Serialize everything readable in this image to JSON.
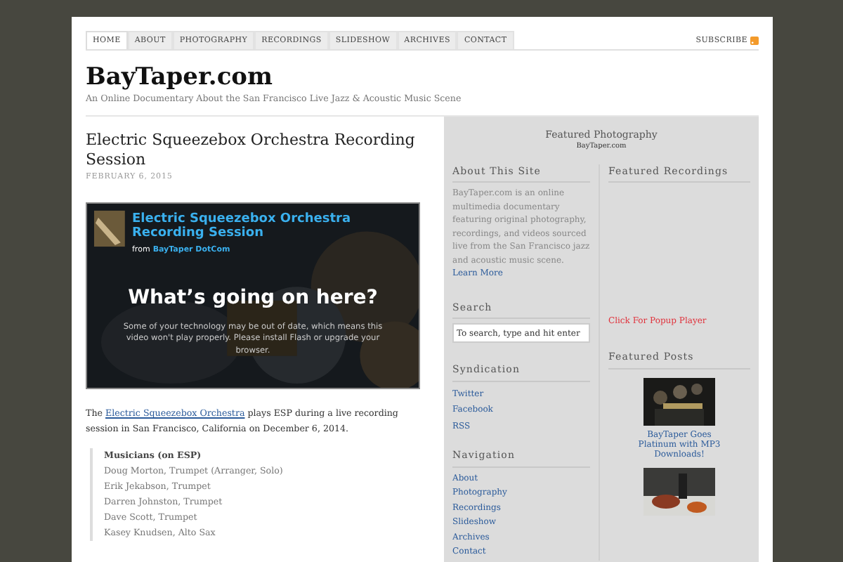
{
  "nav": {
    "tabs": [
      {
        "label": "HOME",
        "selected": true
      },
      {
        "label": "ABOUT",
        "selected": false
      },
      {
        "label": "PHOTOGRAPHY",
        "selected": false
      },
      {
        "label": "RECORDINGS",
        "selected": false
      },
      {
        "label": "SLIDESHOW",
        "selected": false
      },
      {
        "label": "ARCHIVES",
        "selected": false
      },
      {
        "label": "CONTACT",
        "selected": false
      }
    ],
    "subscribe": "SUBSCRIBE"
  },
  "site": {
    "title": "BayTaper.com",
    "tagline": "An Online Documentary About the San Francisco Live Jazz & Acoustic Music Scene"
  },
  "post": {
    "title": "Electric Squeezebox Orchestra Recording Session",
    "date": "FEBRUARY 6, 2015",
    "video": {
      "kind": "picture",
      "title": "Electric Squeezebox Orchestra Recording Session",
      "from": "from",
      "channel": "BayTaper DotCom",
      "heading": "What’s going on here?",
      "message": "Some of your technology may be out of date, which means this video won't play properly. Please install Flash or upgrade your browser."
    },
    "intro_before": "The",
    "intro_link": "Electric Squeezebox Orchestra",
    "intro_after": "plays ESP during a live recording session in San Francisco, California on December 6, 2014.",
    "musicians_heading": "Musicians (on ESP)",
    "musicians": [
      "Doug Morton, Trumpet (Arranger, Solo)",
      "Erik Jekabson, Trumpet",
      "Darren Johnston, Trumpet",
      "Dave Scott, Trumpet",
      "Kasey Knudsen, Alto Sax"
    ]
  },
  "sidebar": {
    "featured_title": "Featured Photography",
    "featured_caption": "BayTaper.com",
    "about": {
      "title": "About This Site",
      "text": "BayTaper.com is an online multimedia documentary featuring original photography, recordings, and videos sourced live from the San Francisco jazz and acoustic music scene.",
      "link": "Learn More"
    },
    "search": {
      "title": "Search",
      "placeholder": "To search, type and hit enter"
    },
    "syndication": {
      "title": "Syndication",
      "links": [
        "Twitter",
        "Facebook",
        "RSS"
      ]
    },
    "navigation": {
      "title": "Navigation",
      "links": [
        "About",
        "Photography",
        "Recordings",
        "Slideshow",
        "Archives",
        "Contact"
      ]
    },
    "recordings": {
      "title": "Featured Recordings",
      "popup": "Click For Popup Player"
    },
    "posts": {
      "title": "Featured Posts",
      "items": [
        {
          "kind": "picture",
          "caption": "BayTaper Goes Platinum with MP3 Downloads!"
        },
        {
          "kind": "picture"
        }
      ]
    }
  }
}
